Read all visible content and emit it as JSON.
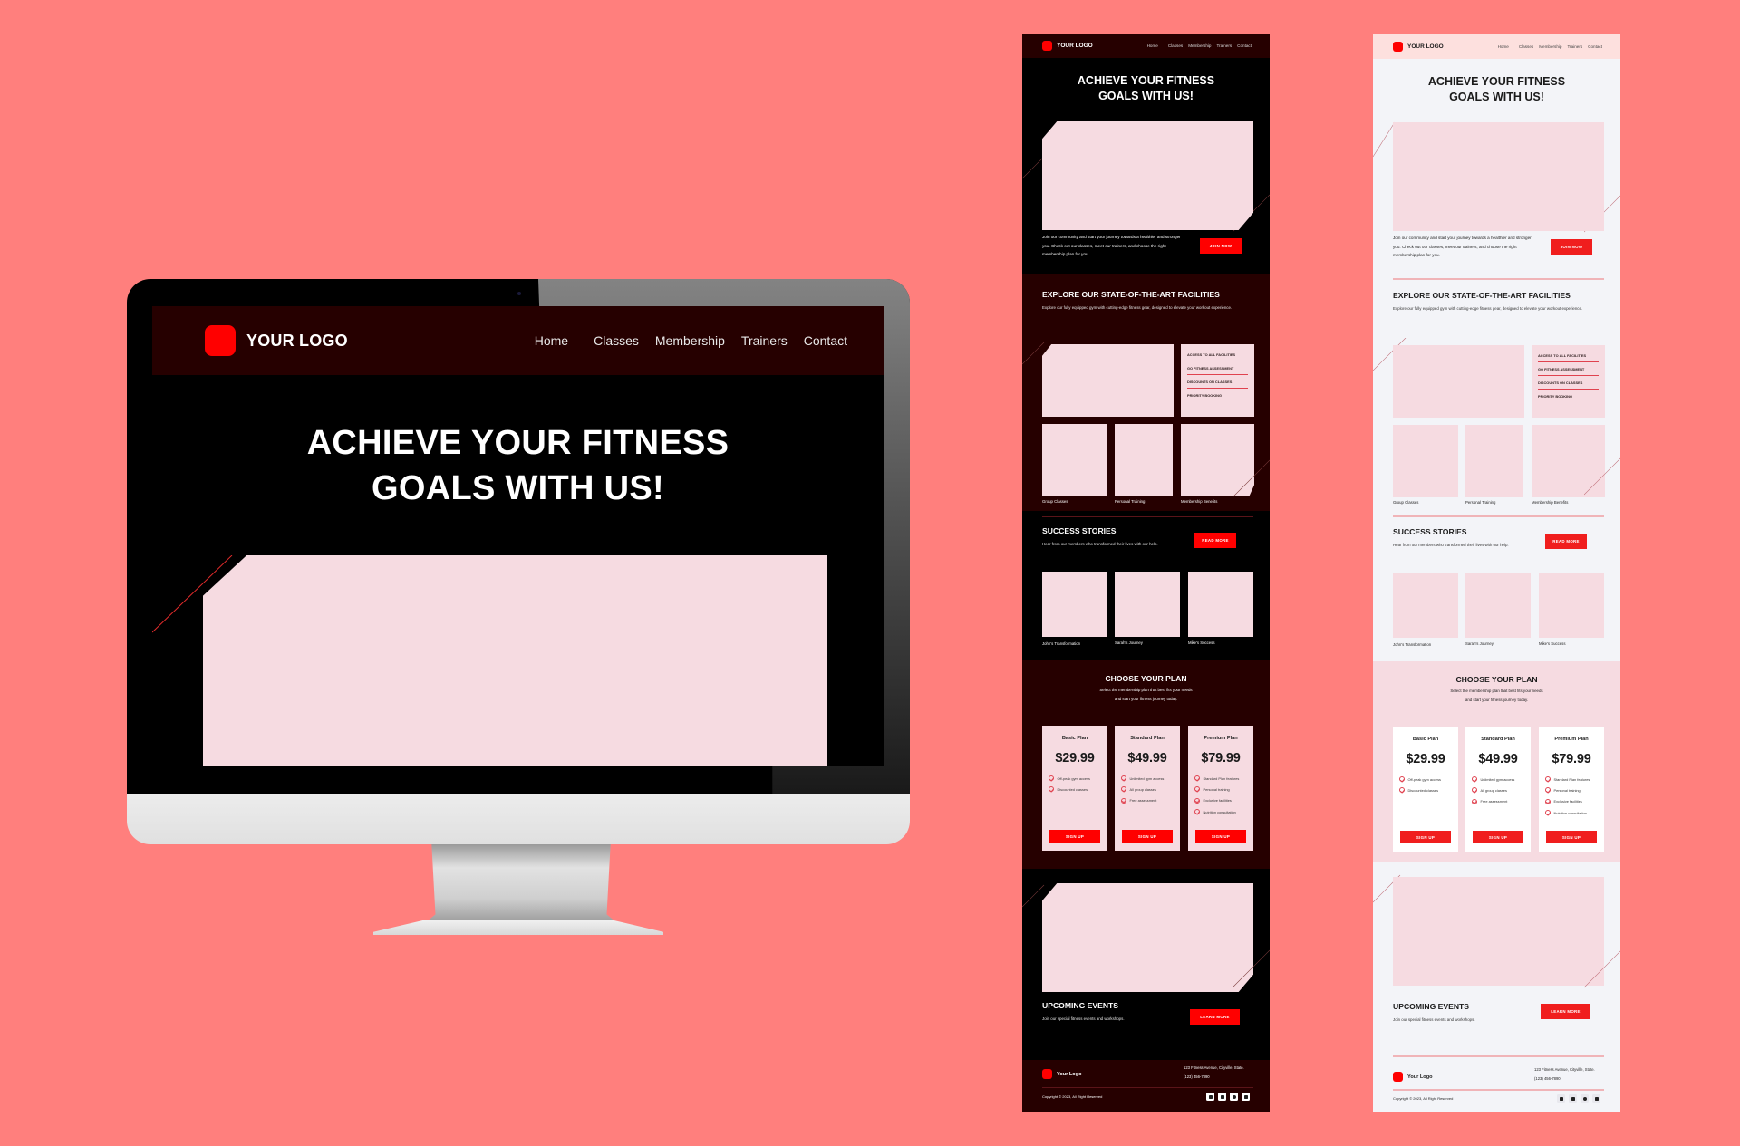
{
  "brand": {
    "logo_text": "YOUR LOGO",
    "footer_logo_text": "Your Logo",
    "accent_color": "#ff0000",
    "dark_bg": "#000000",
    "dark_panel": "#260000",
    "light_bg": "#f3f4f8",
    "placeholder_color": "#f6dbe1",
    "backdrop_color": "#ff7f7d"
  },
  "nav": {
    "items": [
      "Home",
      "Classes",
      "Membership",
      "Trainers",
      "Contact"
    ]
  },
  "hero": {
    "title_line1": "ACHIEVE YOUR FITNESS",
    "title_line2": "GOALS WITH US!",
    "text": "Join our community and start your journey towards a healthier and stronger you. Check out our classes, meet our trainers, and choose the right membership plan for you.",
    "cta_label": "JOIN NOW"
  },
  "facilities": {
    "title": "EXPLORE OUR STATE-OF-THE-ART FACILITIES",
    "description": "Explore our fully equipped gym with cutting-edge fitness gear, designed to elevate your workout experience.",
    "perks": [
      "ACCESS TO ALL FACILITIES",
      "GO FITNESS ASSESSMENT",
      "DISCOUNTS ON CLASSES",
      "PRIORITY BOOKING"
    ],
    "tiles": [
      "Group Classes",
      "Personal Training",
      "Membership Benefits"
    ]
  },
  "stories": {
    "title": "SUCCESS STORIES",
    "description": "Hear from our members who transformed their lives with our help.",
    "cta_label": "READ MORE",
    "items": [
      "John's Transformation",
      "Sarah's Journey",
      "Mike's Success"
    ]
  },
  "plans": {
    "title": "CHOOSE YOUR PLAN",
    "subtitle_line1": "Select the membership plan that best fits your needs",
    "subtitle_line2": "and start your fitness journey today.",
    "items": [
      {
        "name": "Basic Plan",
        "price": "$29.99",
        "features": [
          "Off-peak gym access",
          "Discounted classes"
        ],
        "cta": "SIGN UP"
      },
      {
        "name": "Standard Plan",
        "price": "$49.99",
        "features": [
          "Unlimited gym access",
          "All group classes",
          "Free assessment"
        ],
        "cta": "SIGN UP"
      },
      {
        "name": "Premium Plan",
        "price": "$79.99",
        "features": [
          "Standard Plan features",
          "Personal training",
          "Exclusive facilities",
          "Nutrition consultation"
        ],
        "cta": "SIGN UP"
      }
    ]
  },
  "events": {
    "title": "UPCOMING EVENTS",
    "description": "Join our special fitness events and workshops.",
    "cta_label": "LEARN MORE"
  },
  "footer": {
    "address": "123 Fitness Avenue, Cityville, State.",
    "phone": "(123) 456-7890",
    "copyright": "Copyright © 2023, All Right Reserved",
    "socials": [
      "facebook-icon",
      "linkedin-icon",
      "instagram-icon",
      "twitter-icon"
    ]
  }
}
